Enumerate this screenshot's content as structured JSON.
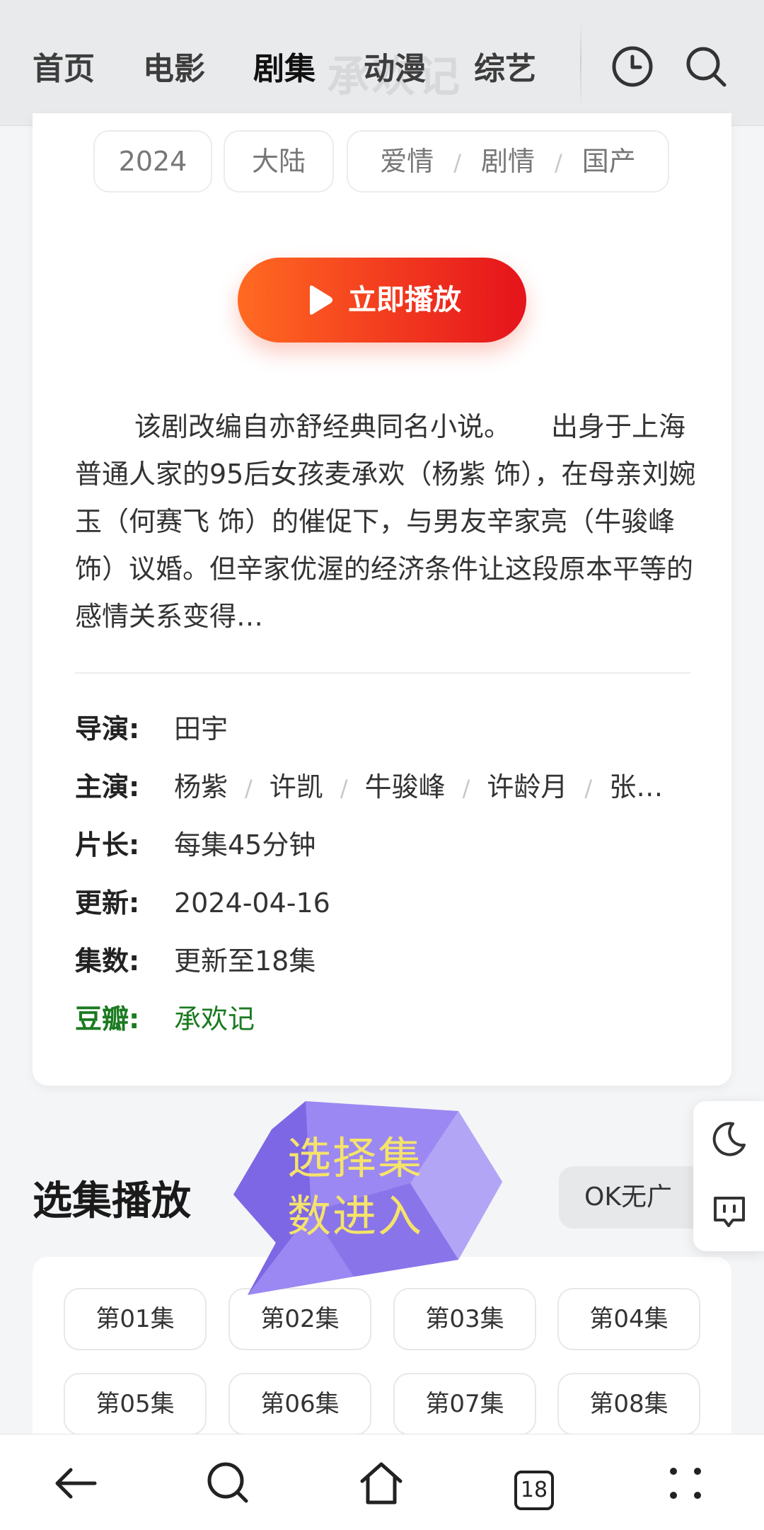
{
  "nav": {
    "items": [
      "首页",
      "电影",
      "剧集",
      "动漫",
      "综艺"
    ],
    "active_index": 2,
    "ghost_title": "承欢记"
  },
  "tags": {
    "year": "2024",
    "region": "大陆",
    "genres": [
      "爱情",
      "剧情",
      "国产"
    ]
  },
  "play_button": {
    "label": "立即播放"
  },
  "description": "该剧改编自亦舒经典同名小说。　　出身于上海普通人家的95后女孩麦承欢（杨紫 饰），在母亲刘婉玉（何赛飞 饰）的催促下，与男友辛家亮（牛骏峰 饰）议婚。但辛家优渥的经济条件让这段原本平等的感情关系变得…",
  "info": {
    "director_label": "导演:",
    "director": "田宇",
    "cast_label": "主演:",
    "cast": [
      "杨紫",
      "许凯",
      "牛骏峰",
      "许龄月",
      "张…"
    ],
    "duration_label": "片长:",
    "duration": "每集45分钟",
    "updated_label": "更新:",
    "updated": "2024-04-16",
    "episodes_label": "集数:",
    "episodes": "更新至18集",
    "douban_label": "豆瓣:",
    "douban": "承欢记"
  },
  "episodes_section": {
    "title": "选集播放",
    "source": "OK无广",
    "episodes": [
      "第01集",
      "第02集",
      "第03集",
      "第04集",
      "第05集",
      "第06集",
      "第07集",
      "第08集"
    ]
  },
  "overlay_bubble": {
    "text_line1": "选择集",
    "text_line2": "数进入"
  },
  "browser_bar": {
    "tab_count": "18"
  },
  "colors": {
    "accent_highlight": "#f7c948",
    "play_gradient_start": "#ff6a21",
    "play_gradient_end": "#e5131b",
    "douban_green": "#1b7b21",
    "bubble_purple": "#8f7cf0",
    "bubble_text": "#f5e36b"
  }
}
